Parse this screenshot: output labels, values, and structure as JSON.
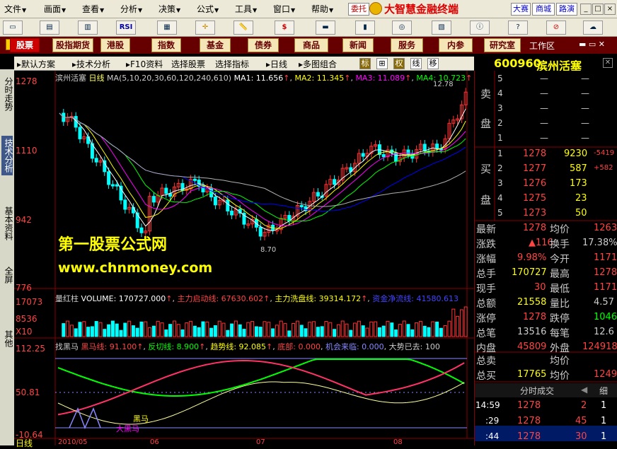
{
  "menu": {
    "items": [
      "文件",
      "画面",
      "查看",
      "分析",
      "决策",
      "公式",
      "工具",
      "窗口",
      "帮助"
    ],
    "weituo": "委托",
    "brand": "大智慧金融终端",
    "dasai": "大赛",
    "shangcheng": "商城",
    "luyan": "路演"
  },
  "toolbar": {
    "rsi": "RSI",
    "dollar": "$"
  },
  "modes": [
    "股票",
    "股指期货",
    "港股",
    "指数",
    "基金",
    "债券",
    "商品",
    "新闻",
    "服务",
    "内参",
    "研究室"
  ],
  "work_area": "工作区",
  "subtabs": {
    "scheme": "默认方案",
    "tech": "技术分析",
    "f10": "F10资料",
    "select_stock": "选择股票",
    "select_indicator": "选择指标",
    "period": "日线",
    "multi": "多图组合",
    "biao": "标",
    "quan": "权",
    "xian": "线",
    "yi": "移"
  },
  "left_tabs": [
    "分时走势",
    "技术分析",
    "基本资料",
    "全屏",
    "其他"
  ],
  "stock": {
    "code": "600960",
    "name": "滨州活塞"
  },
  "main_chart": {
    "title": "滨州活塞",
    "period": "日线",
    "ma_params": "MA(5,10,20,30,60,120,240,610)",
    "ma1": "MA1: 11.656",
    "ma2": "MA2: 11.345",
    "ma3": "MA3: 11.089",
    "ma4": "MA4: 10.723",
    "y_labels": [
      "1278",
      "1110",
      "942",
      "776"
    ],
    "high_label": "12.78",
    "low_label": "8.70",
    "watermark1": "第一股票公式网",
    "watermark2": "www.chnmoney.com"
  },
  "volume_panel": {
    "title": "量红柱",
    "volume": "VOLUME: 170727.000",
    "zlqd": "主力启动线: 67630.602",
    "zlxp": "主力洗盘线: 39314.172",
    "zjlr": "资金净流线: 41580.613",
    "y_labels": [
      "17073",
      "8536",
      "X10"
    ]
  },
  "indicator_panel": {
    "title": "找黑马",
    "hmx": "黑马线: 91.100",
    "fqx": "反切线: 8.900",
    "qsx": "趋势线: 92.085",
    "db": "底部: 0.000",
    "jhll": "机会来临: 0.000",
    "dsyq": "大势已去: 100",
    "y_labels": [
      "112.25",
      "50.81",
      "-10.64"
    ],
    "heima": "黑马",
    "daheima": "大黑马"
  },
  "bottom": {
    "period": "日线",
    "dates": [
      "2010/05",
      "06",
      "07",
      "08"
    ]
  },
  "order_book": {
    "sell_label": [
      "卖",
      "盘"
    ],
    "buy_label": [
      "买",
      "盘"
    ],
    "sell": [
      {
        "lvl": "5",
        "price": "—",
        "vol": "—"
      },
      {
        "lvl": "4",
        "price": "—",
        "vol": "—"
      },
      {
        "lvl": "3",
        "price": "—",
        "vol": "—"
      },
      {
        "lvl": "2",
        "price": "—",
        "vol": "—"
      },
      {
        "lvl": "1",
        "price": "—",
        "vol": "—"
      }
    ],
    "buy": [
      {
        "lvl": "1",
        "price": "1278",
        "vol": "9230",
        "chg": "-5419"
      },
      {
        "lvl": "2",
        "price": "1277",
        "vol": "587",
        "chg": "+582"
      },
      {
        "lvl": "3",
        "price": "1276",
        "vol": "173",
        "chg": ""
      },
      {
        "lvl": "4",
        "price": "1275",
        "vol": "23",
        "chg": ""
      },
      {
        "lvl": "5",
        "price": "1273",
        "vol": "50",
        "chg": ""
      }
    ]
  },
  "quote": [
    {
      "l": "最新",
      "v": "1278",
      "l2": "均价",
      "v2": "1263"
    },
    {
      "l": "涨跌",
      "v": "116",
      "l2": "换手",
      "v2": "17.38%"
    },
    {
      "l": "涨幅",
      "v": "9.98%",
      "l2": "今开",
      "v2": "1171"
    },
    {
      "l": "总手",
      "v": "170727",
      "l2": "最高",
      "v2": "1278"
    },
    {
      "l": "现手",
      "v": "30",
      "l2": "最低",
      "v2": "1171"
    },
    {
      "l": "总额",
      "v": "21558",
      "l2": "量比",
      "v2": "4.57"
    },
    {
      "l": "涨停",
      "v": "1278",
      "l2": "跌停",
      "v2": "1046"
    },
    {
      "l": "总笔",
      "v": "13516",
      "l2": "每笔",
      "v2": "12.6"
    },
    {
      "l": "内盘",
      "v": "45809",
      "l2": "外盘",
      "v2": "124918"
    }
  ],
  "totals": [
    {
      "l": "总卖",
      "v": "",
      "l2": "均价",
      "v2": ""
    },
    {
      "l": "总买",
      "v": "17765",
      "l2": "均价",
      "v2": "1249"
    }
  ],
  "ticks_header": "分时成交",
  "ticks_detail": "细",
  "ticks": [
    {
      "t": "14:59",
      "p": "1278",
      "v": "2",
      "n": "1"
    },
    {
      "t": ":29",
      "p": "1278",
      "v": "45",
      "n": "1"
    },
    {
      "t": ":44",
      "p": "1278",
      "v": "30",
      "n": "1"
    }
  ],
  "colors": {
    "up": "#ff3232",
    "down": "#00ffff",
    "ma1": "#ffffff",
    "ma2": "#ffff00",
    "ma3": "#ff00ff",
    "ma4": "#00ff00",
    "ma5": "#0000ff",
    "ma6": "#b0b0b0",
    "accent": "#ffff00"
  }
}
